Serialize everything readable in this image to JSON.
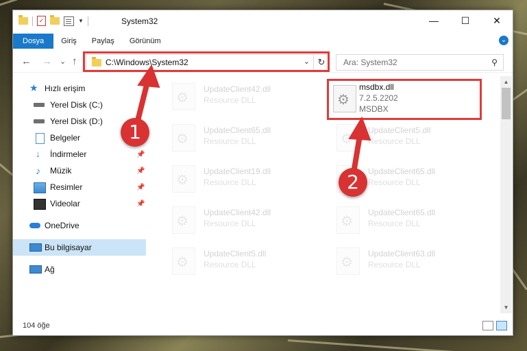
{
  "window": {
    "title": "System32",
    "min_glyph": "—",
    "max_glyph": "☐",
    "close_glyph": "✕"
  },
  "ribbon": {
    "tabs": [
      "Dosya",
      "Giriş",
      "Paylaş",
      "Görünüm"
    ],
    "expand_glyph": "⌄"
  },
  "address": {
    "path": "C:\\Windows\\System32",
    "search_placeholder": "Ara: System32",
    "back_glyph": "←",
    "forward_glyph": "→",
    "recent_glyph": "⌄",
    "up_glyph": "↑",
    "dropdown_glyph": "⌄",
    "refresh_glyph": "↻",
    "search_glyph": "⚲"
  },
  "sidebar": {
    "items": [
      {
        "label": "Hızlı erişim",
        "icon": "star-icon"
      },
      {
        "label": "Yerel Disk (C:)",
        "icon": "drive-icon"
      },
      {
        "label": "Yerel Disk (D:)",
        "icon": "drive-icon"
      },
      {
        "label": "Belgeler",
        "icon": "document-icon"
      },
      {
        "label": "İndirmeler",
        "icon": "download-icon",
        "pinned": true
      },
      {
        "label": "Müzik",
        "icon": "music-icon",
        "pinned": true
      },
      {
        "label": "Resimler",
        "icon": "pictures-icon",
        "pinned": true
      },
      {
        "label": "Videolar",
        "icon": "video-icon",
        "pinned": true
      },
      {
        "label": "OneDrive",
        "icon": "cloud-icon"
      },
      {
        "label": "Bu bilgisayar",
        "icon": "computer-icon",
        "selected": true
      },
      {
        "label": "Ağ",
        "icon": "network-icon"
      }
    ],
    "pin_glyph": "📌"
  },
  "files": {
    "highlighted": {
      "name": "msdbx.dll",
      "version": "7.2.5.2202",
      "description": "MSDBX"
    },
    "background": [
      {
        "name": "UpdateClient42.dll",
        "type": "Resource DLL"
      },
      {
        "name": "UpdateClient65.dll",
        "type": "Resource DLL"
      },
      {
        "name": "UpdateClient5.dll",
        "type": "Resource DLL"
      },
      {
        "name": "UpdateClient19.dll",
        "type": "Resource DLL"
      },
      {
        "name": "UpdateClient65.dll",
        "type": "Resource DLL"
      },
      {
        "name": "UpdateClient42.dll",
        "type": "Resource DLL"
      },
      {
        "name": "UpdateClient65.dll",
        "type": "Resource DLL"
      },
      {
        "name": "UpdateClient5.dll",
        "type": "Resource DLL"
      },
      {
        "name": "UpdateClient63.dll",
        "type": "Resource DLL"
      }
    ]
  },
  "status": {
    "item_count": "104 öğe"
  },
  "annotations": {
    "step1": "1",
    "step2": "2",
    "color": "#d93232"
  },
  "colors": {
    "accent": "#1979ca",
    "selection": "#cce4f7",
    "highlight": "#e03a3a"
  }
}
